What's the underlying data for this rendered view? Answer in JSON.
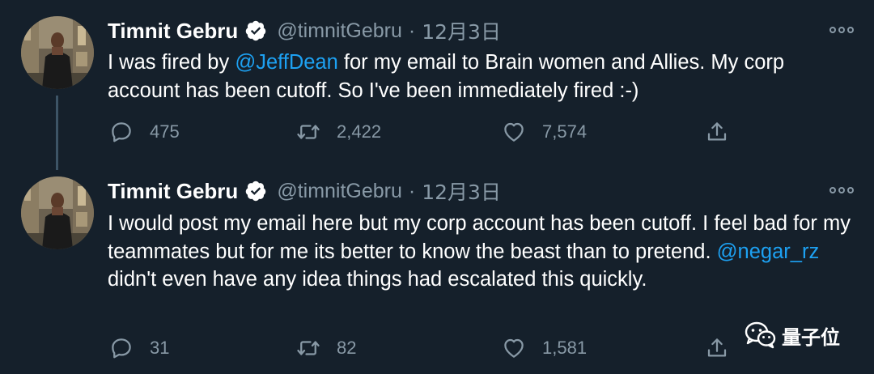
{
  "colors": {
    "background": "#15202b",
    "text": "#ffffff",
    "secondary": "#8899a6",
    "link": "#1da1f2",
    "verified": "#ffffff"
  },
  "tweets": [
    {
      "author": {
        "name": "Timnit Gebru",
        "handle": "@timnitGebru",
        "separator": "·",
        "date": "12月3日",
        "verified": true
      },
      "body": {
        "part1": "I was fired by ",
        "mention1": "@JeffDean",
        "part2": " for my email to Brain women and Allies. My corp account has been cutoff. So I've been immediately fired :-)"
      },
      "actions": {
        "replies": "475",
        "retweets": "2,422",
        "likes": "7,574"
      }
    },
    {
      "author": {
        "name": "Timnit Gebru",
        "handle": "@timnitGebru",
        "separator": "·",
        "date": "12月3日",
        "verified": true
      },
      "body": {
        "part1": "I would post my email here but my corp account has been cutoff. I feel bad for my teammates but for me its better to know the beast than to pretend. ",
        "mention1": "@negar_rz",
        "part2": " didn't even have any idea things had escalated this quickly."
      },
      "actions": {
        "replies": "31",
        "retweets": "82",
        "likes": "1,581"
      }
    }
  ],
  "watermark": {
    "text": "量子位",
    "icon": "wechat-logo-icon"
  }
}
